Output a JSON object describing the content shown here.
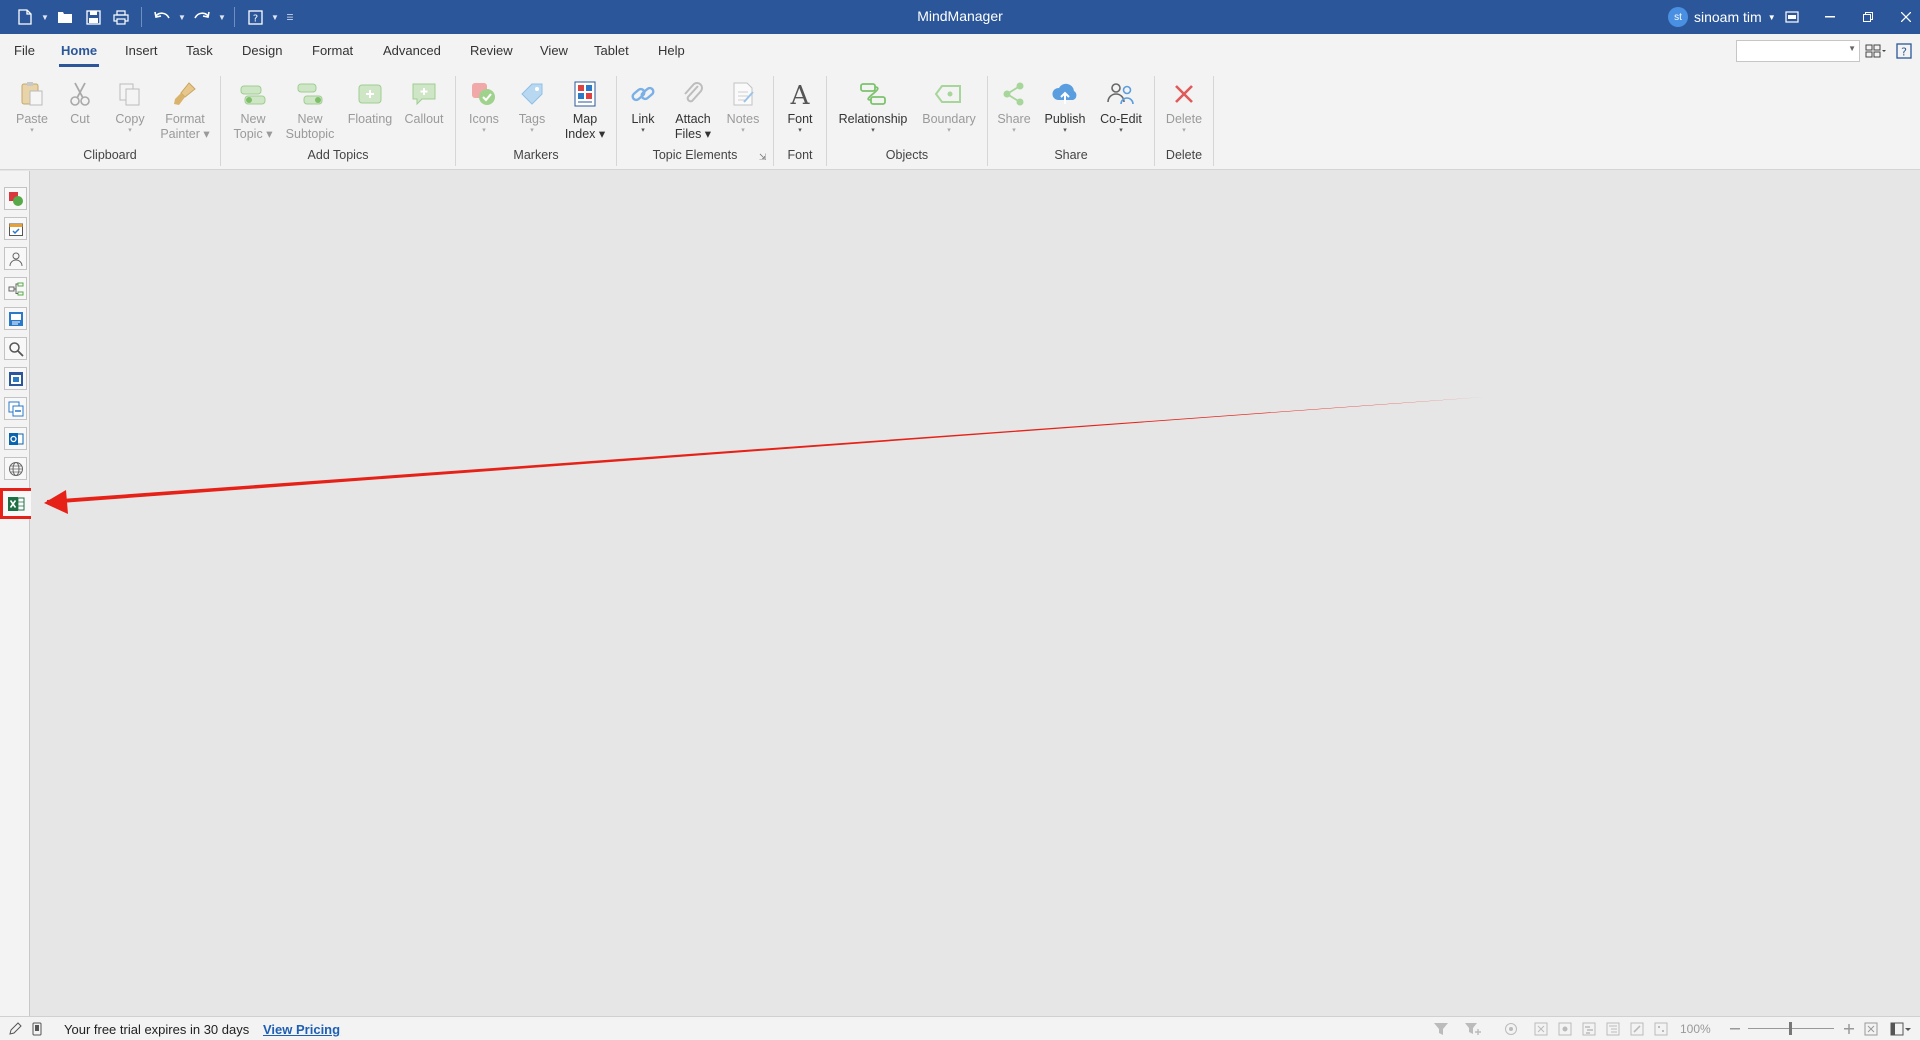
{
  "window": {
    "title": "MindManager"
  },
  "user": {
    "initials": "st",
    "name": "sinoam tim"
  },
  "menu": {
    "tabs": [
      {
        "label": "File"
      },
      {
        "label": "Home"
      },
      {
        "label": "Insert"
      },
      {
        "label": "Task"
      },
      {
        "label": "Design"
      },
      {
        "label": "Format"
      },
      {
        "label": "Advanced"
      },
      {
        "label": "Review"
      },
      {
        "label": "View"
      },
      {
        "label": "Tablet"
      },
      {
        "label": "Help"
      }
    ],
    "active_tab": "Home"
  },
  "ribbon": {
    "clipboard": {
      "label": "Clipboard",
      "paste": "Paste",
      "cut": "Cut",
      "copy": "Copy",
      "format_painter_1": "Format",
      "format_painter_2": "Painter"
    },
    "add_topics": {
      "label": "Add Topics",
      "new_topic_1": "New",
      "new_topic_2": "Topic",
      "new_subtopic_1": "New",
      "new_subtopic_2": "Subtopic",
      "floating": "Floating",
      "callout": "Callout"
    },
    "markers": {
      "label": "Markers",
      "icons": "Icons",
      "tags": "Tags",
      "map_index_1": "Map",
      "map_index_2": "Index"
    },
    "topic_elements": {
      "label": "Topic Elements",
      "link": "Link",
      "attach_1": "Attach",
      "attach_2": "Files",
      "notes": "Notes"
    },
    "font": {
      "label": "Font",
      "font": "Font"
    },
    "objects": {
      "label": "Objects",
      "relationship": "Relationship",
      "boundary": "Boundary"
    },
    "share": {
      "label": "Share",
      "share": "Share",
      "publish": "Publish",
      "coedit": "Co-Edit"
    },
    "delete": {
      "label": "Delete",
      "delete": "Delete"
    }
  },
  "status": {
    "trial": "Your free trial expires in 30 days",
    "pricing": "View Pricing",
    "zoom": "100%",
    "zoom_level": 0.5
  },
  "colors": {
    "titlebar": "#2b579a",
    "accent": "#2b579a",
    "annotation": "#e62117",
    "link": "#1d5fb4"
  }
}
